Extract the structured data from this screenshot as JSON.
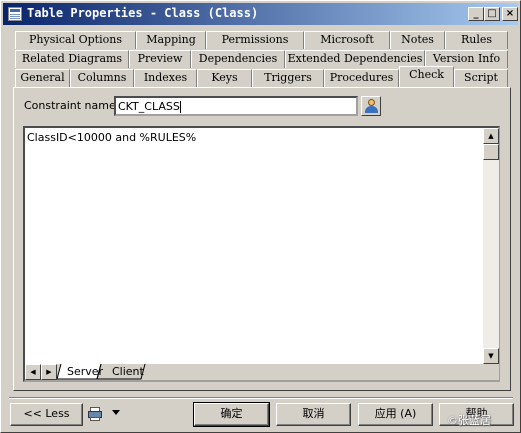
{
  "window": {
    "title": "Table Properties - Class (Class)"
  },
  "title_controls": {
    "minimize": "_",
    "maximize": "□",
    "close": "×"
  },
  "tabs": {
    "row1": [
      "Physical Options",
      "Mapping",
      "Permissions",
      "Microsoft",
      "Notes",
      "Rules"
    ],
    "row2": [
      "Related Diagrams",
      "Preview",
      "Dependencies",
      "Extended Dependencies",
      "Version Info"
    ],
    "row3": [
      "General",
      "Columns",
      "Indexes",
      "Keys",
      "Triggers",
      "Procedures",
      "Check",
      "Script"
    ],
    "active": "Check"
  },
  "constraint": {
    "label": "Constraint name:",
    "value": "CKT_CLASS"
  },
  "editor": {
    "content": "ClassID<10000 and %RULES%"
  },
  "editor_tabs": [
    "Server",
    "Client"
  ],
  "footer": {
    "less": "<< Less",
    "ok": "确定",
    "cancel": "取消",
    "apply": "应用 (A)",
    "help": "帮助"
  },
  "watermark": "©张蓝居"
}
